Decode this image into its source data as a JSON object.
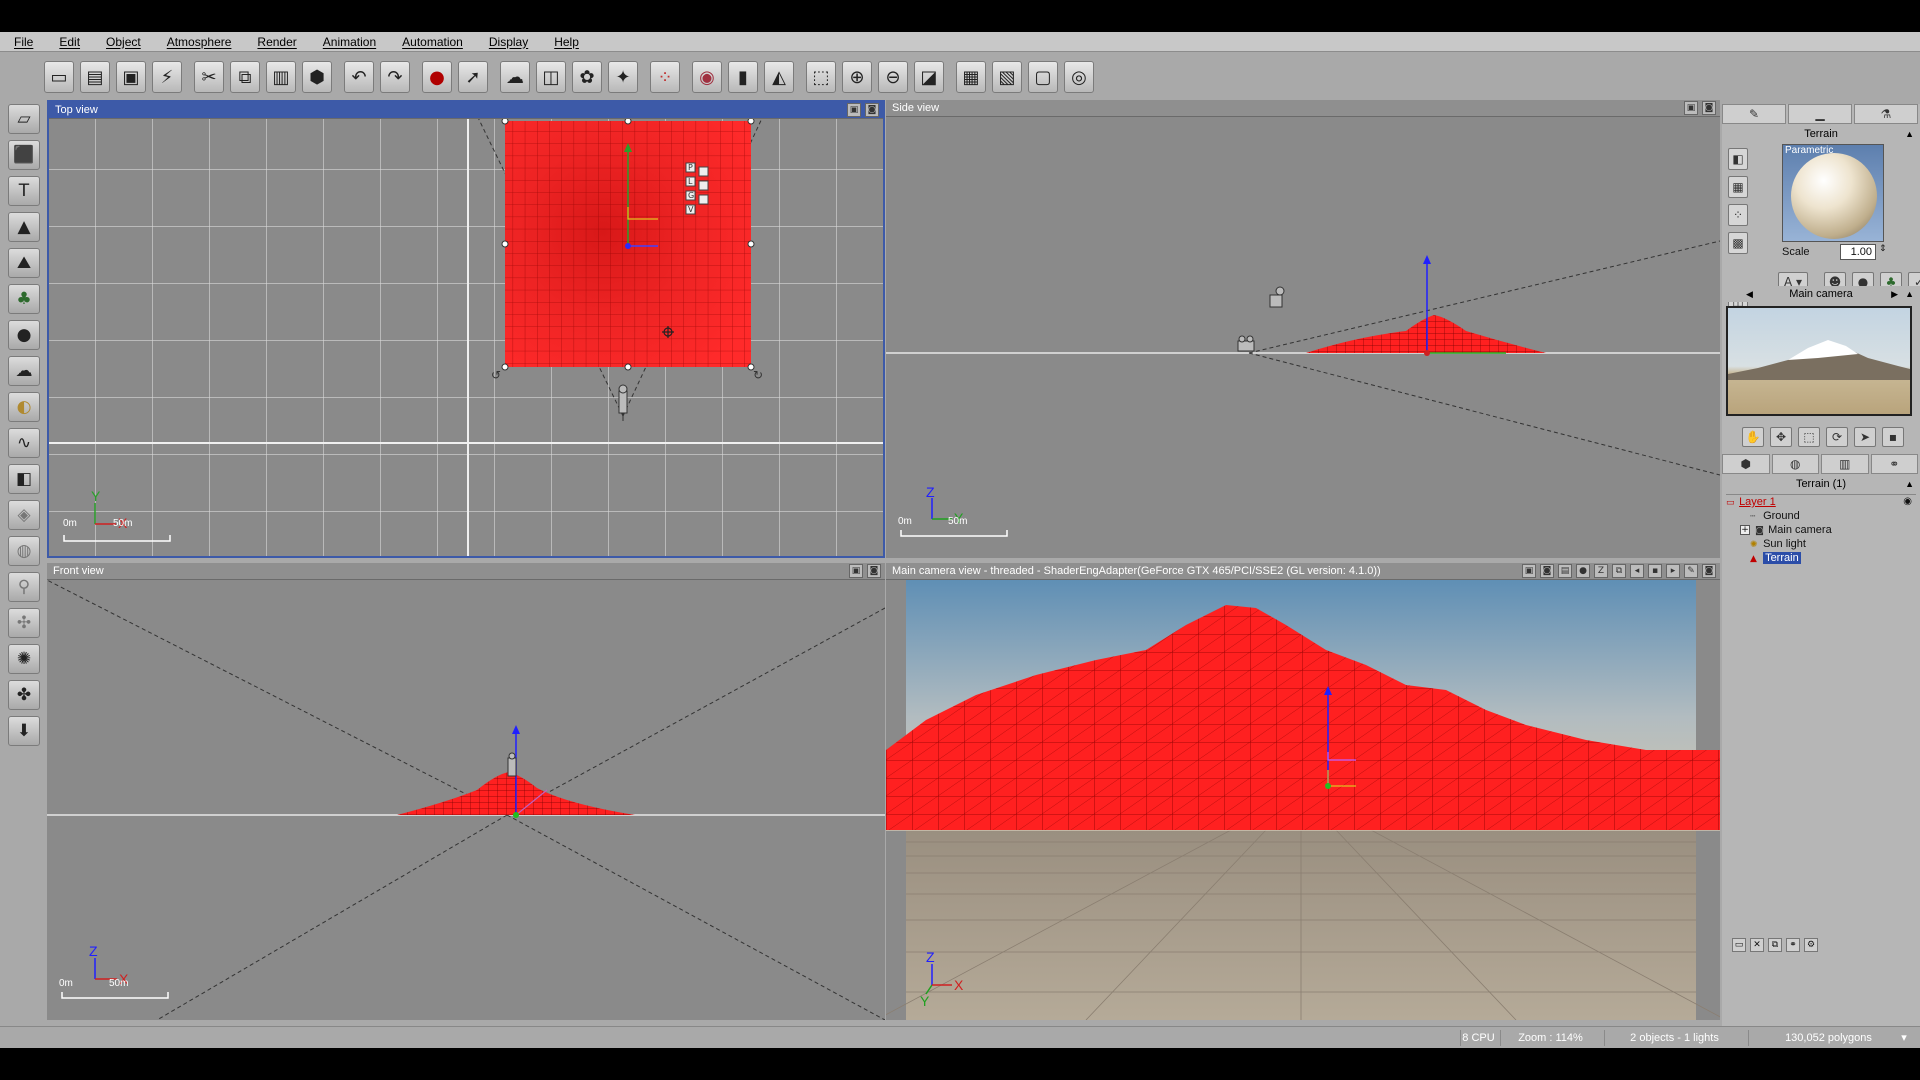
{
  "menu": [
    "File",
    "Edit",
    "Object",
    "Atmosphere",
    "Render",
    "Animation",
    "Automation",
    "Display",
    "Help"
  ],
  "toolbar_icons": [
    "new-icon",
    "open-icon",
    "save-icon",
    "save-as-icon",
    "cut-icon",
    "copy-icon",
    "paste-icon",
    "object-icon",
    "undo-icon",
    "redo-icon",
    "record-icon",
    "select-icon",
    "cloud-icon",
    "box-icon",
    "plant-icon",
    "wand-icon",
    "spheres-icon",
    "globe-icon",
    "bar-icon",
    "mirror-icon",
    "zoom-region-icon",
    "zoom-in-icon",
    "zoom-out-icon",
    "fit-icon",
    "film-icon",
    "clapper-icon",
    "frame-icon",
    "camera-icon"
  ],
  "left_tools": [
    "plane-tool",
    "cube-tool",
    "text-tool",
    "terrain-tool",
    "mountain-tool",
    "tree-tool",
    "rock-tool",
    "cloud-tool",
    "planet-tool",
    "curve-tool",
    "object-tool",
    "gray-tool-1",
    "gray-tool-2",
    "gray-tool-3",
    "gray-tool-4",
    "light-tool",
    "fan-tool",
    "export-tool"
  ],
  "viewports": {
    "top": {
      "title": "Top view",
      "scale_start": "0m",
      "scale_end": "50m",
      "axis1": "Y",
      "axis2": "X"
    },
    "side": {
      "title": "Side view",
      "scale_start": "0m",
      "scale_end": "50m",
      "axis1": "Z",
      "axis2": "Y"
    },
    "front": {
      "title": "Front view",
      "scale_start": "0m",
      "scale_end": "50m",
      "axis1": "Z",
      "axis2": "X"
    },
    "camera": {
      "title": "Main camera view - threaded - ShaderEngAdapter(GeForce GTX 465/PCI/SSE2 (GL version: 4.1.0))",
      "axis1": "Z",
      "axis2": "Y",
      "axis3": "X"
    }
  },
  "top_view_gizmo_letters": [
    "P",
    "L",
    "G",
    "V"
  ],
  "right_panel": {
    "tabs": [
      "brush-icon",
      "ruler-icon",
      "eyedropper-icon"
    ],
    "object_title": "Terrain",
    "material_label": "Parametric",
    "scale_label": "Scale",
    "scale_value": "1.00",
    "camera_title": "Main camera",
    "tree_title": "Terrain (1)",
    "tree": [
      {
        "label": "Layer 1",
        "type": "layer"
      },
      {
        "label": "Ground",
        "type": "item"
      },
      {
        "label": "Main camera",
        "type": "item"
      },
      {
        "label": "Sun light",
        "type": "item"
      },
      {
        "label": "Terrain",
        "type": "item",
        "selected": true
      }
    ]
  },
  "status": {
    "cpu": "8 CPU",
    "zoom": "Zoom : 114%",
    "objects": "2 objects - 1 lights",
    "polygons": "130,052 polygons"
  },
  "colors": {
    "terrain": "#ff2020",
    "viewport_bg": "#8a8a8a",
    "active_title": "#3d5aa8",
    "sky_top": "#5f8fb5",
    "sky_bottom": "#d5c7ad",
    "ground": "#a59886"
  }
}
